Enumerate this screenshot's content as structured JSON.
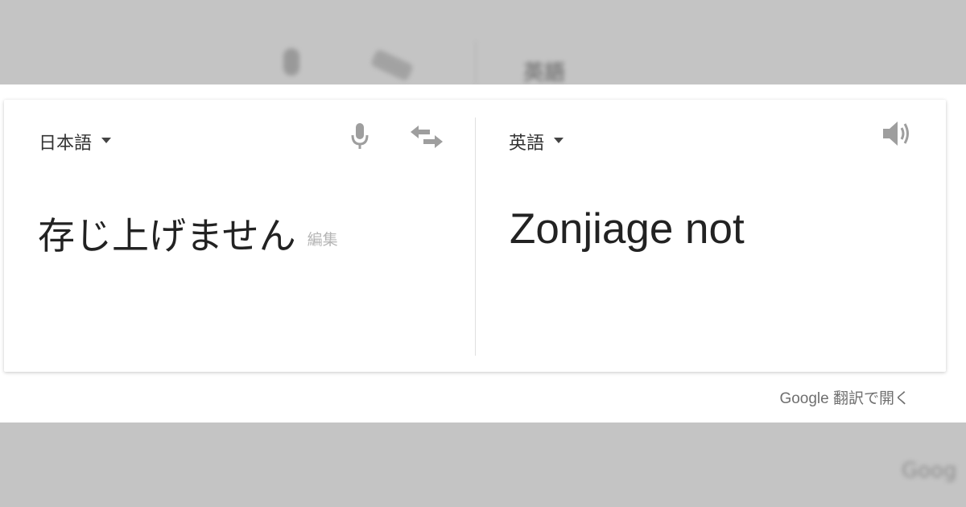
{
  "background": {
    "top_ghost_label": "英語",
    "bottom_ghost_label": "Goog"
  },
  "source": {
    "language": "日本語",
    "text": "存じ上げません",
    "edit_label": "編集"
  },
  "target": {
    "language": "英語",
    "text": "Zonjiage not"
  },
  "footer": {
    "open_link": "Google 翻訳で開く"
  },
  "icons": {
    "mic": "microphone-icon",
    "swap": "swap-languages-icon",
    "speaker": "speaker-icon",
    "dropdown": "dropdown-caret-icon"
  },
  "colors": {
    "icon_gray": "#9e9e9e",
    "text_dark": "#222222",
    "text_muted": "#b5b5b5",
    "link_gray": "#6f6f6f"
  }
}
